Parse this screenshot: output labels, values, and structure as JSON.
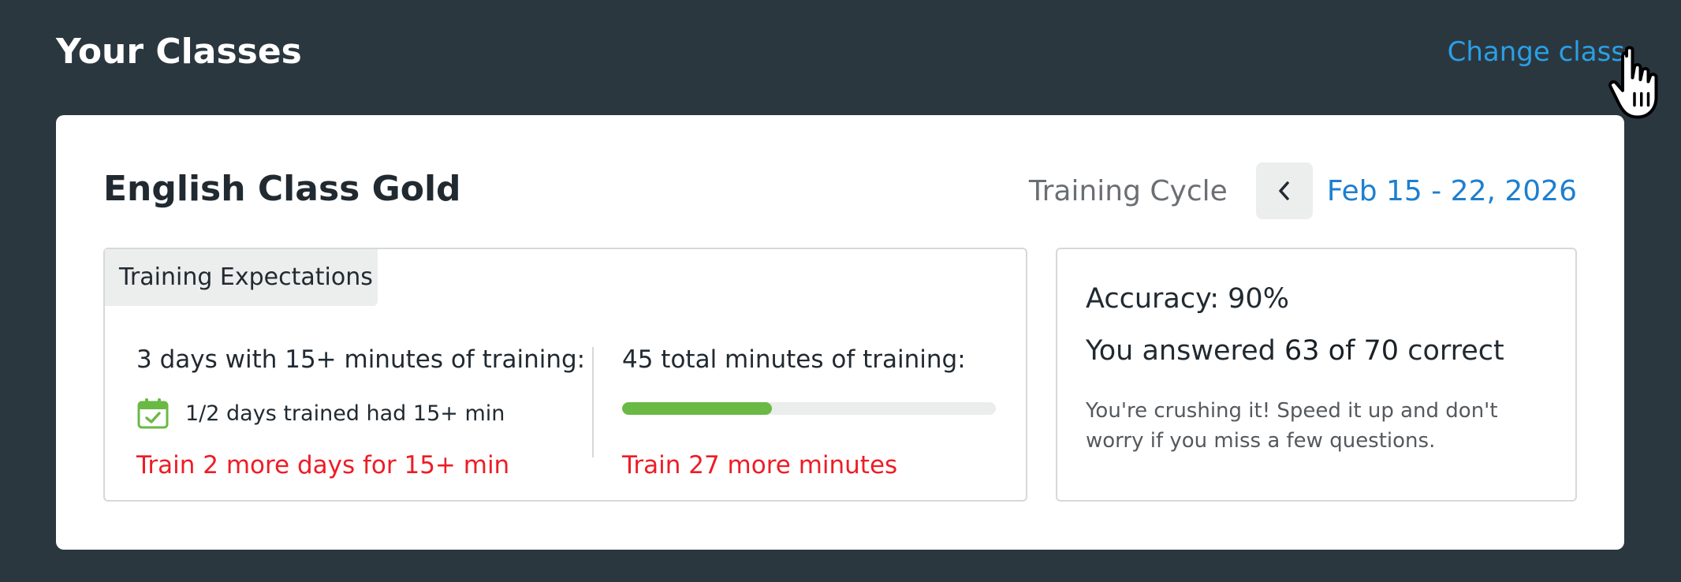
{
  "header": {
    "title": "Your Classes",
    "change_class_label": "Change class"
  },
  "class_card": {
    "name": "English Class Gold",
    "cycle_label": "Training Cycle",
    "cycle_dates": "Feb 15 - 22, 2026"
  },
  "expectations": {
    "tab_label": "Training Expectations",
    "days": {
      "heading": "3 days with 15+ minutes of training:",
      "status": "1/2 days trained had 15+ min",
      "warning": "Train 2 more days for 15+ min"
    },
    "minutes": {
      "heading": "45 total minutes of training:",
      "progress_fraction": 0.4,
      "warning": "Train 27 more minutes"
    }
  },
  "accuracy": {
    "title": "Accuracy: 90%",
    "answered_prefix": "You answered",
    "answered_score": "63 of 70",
    "answered_suffix": "correct",
    "message": "You're crushing it! Speed it up and don't worry if you miss a few questions."
  },
  "icons": {
    "calendar": "calendar-check-icon",
    "prev": "chevron-left-icon",
    "cursor": "hand-pointer-cursor"
  },
  "colors": {
    "page_background": "#2b373f",
    "link": "#2a9fe6",
    "date_link": "#1d7fd0",
    "warning": "#ee1c25",
    "progress": "#6ab945"
  }
}
